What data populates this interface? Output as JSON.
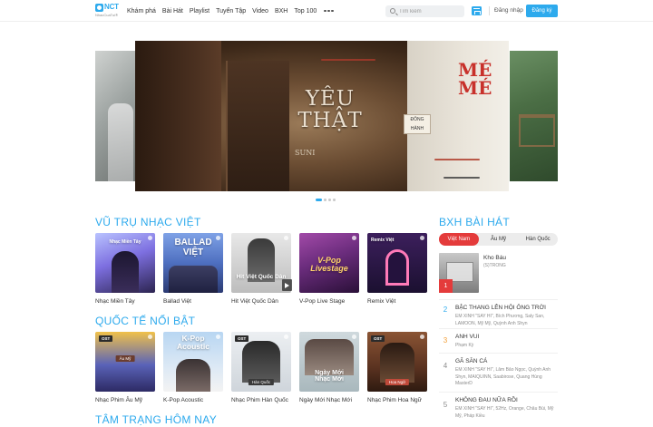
{
  "header": {
    "logo_brand": "NCT",
    "logo_tagline": "NhacCuaTui®",
    "nav": [
      "Khám phá",
      "Bài Hát",
      "Playlist",
      "Tuyển Tập",
      "Video",
      "BXH",
      "Top 100"
    ],
    "search_placeholder": "Tìm kiếm",
    "login": "Đăng nhập",
    "signup": "Đăng ký"
  },
  "hero": {
    "title": "YÊU THẬT",
    "subtitle": "SUNI",
    "sign_text": "ĐÔNG HÀNH",
    "wall_text": "MÉ MÉ",
    "slide_count": 4,
    "active_slide": 0
  },
  "sections": {
    "vu_tru": {
      "title": "VŨ TRỤ NHẠC VIỆT",
      "items": [
        {
          "label": "Nhạc Miền Tây",
          "cover_text": "Nhạc Miền Tây"
        },
        {
          "label": "Ballad Việt",
          "cover_text": "BALLAD VIỆT"
        },
        {
          "label": "Hit Việt Quốc Dân",
          "cover_text": "Hit Việt Quốc Dân"
        },
        {
          "label": "V-Pop Live Stage",
          "cover_text": "V-Pop Livestage"
        },
        {
          "label": "Remix Việt",
          "cover_text": "Remix Việt"
        }
      ]
    },
    "quoc_te": {
      "title": "QUỐC TẾ NỔI BẬT",
      "items": [
        {
          "label": "Nhạc Phim Âu Mỹ",
          "cover_text": "Âu Mỹ",
          "ost": "OST"
        },
        {
          "label": "K-Pop Acoustic",
          "cover_text": "K-Pop Acoustic"
        },
        {
          "label": "Nhạc Phim Hàn Quốc",
          "cover_text": "Hàn Quốc",
          "ost": "OST"
        },
        {
          "label": "Ngày Mới Nhạc Mới",
          "cover_text": "Ngày Mới Nhạc Mới"
        },
        {
          "label": "Nhạc Phim Hoa Ngữ",
          "cover_text": "Hoa Ngữ",
          "ost": "OST"
        }
      ]
    },
    "tam_trang": {
      "title": "TÂM TRẠNG HÔM NAY"
    }
  },
  "bxh": {
    "title": "BXH BÀI HÁT",
    "tabs": [
      "Việt Nam",
      "Âu Mỹ",
      "Hàn Quốc"
    ],
    "active_tab": 0,
    "top": {
      "rank": "1",
      "title": "Kho Báu",
      "artist": "(S)TRONG"
    },
    "rows": [
      {
        "rank": "2",
        "title": "BẬC THANG LÊN HỘI ÔNG TRỜI",
        "artist": "EM XINH \"SAY HI\", Bích Phương, Saly San, LAMOON, Mỹ Mỹ, Quỳnh Anh Shyn"
      },
      {
        "rank": "3",
        "title": "ANH VUI",
        "artist": "Phạm Kỳ"
      },
      {
        "rank": "4",
        "title": "GÃ SĂN CÁ",
        "artist": "EM XINH \"SAY HI\", Lâm Bảo Ngọc, Quỳnh Anh Shyn, MAIQUINN, Saabirose, Quang Hùng MasterD"
      },
      {
        "rank": "5",
        "title": "KHÔNG ĐAU NỮA RỒI",
        "artist": "EM XINH \"SAY HI\", 52Hz, Orange, Châu Bùi, Mỹ Mỹ, Pháp Kiều"
      }
    ],
    "rank_colors": {
      "1": "#e43b3b",
      "2": "#2daaed",
      "3": "#f29e38",
      "4": "#8c8c8c",
      "5": "#8c8c8c"
    }
  },
  "colors": {
    "accent": "#2daaed",
    "chart_red": "#e43b3b"
  }
}
